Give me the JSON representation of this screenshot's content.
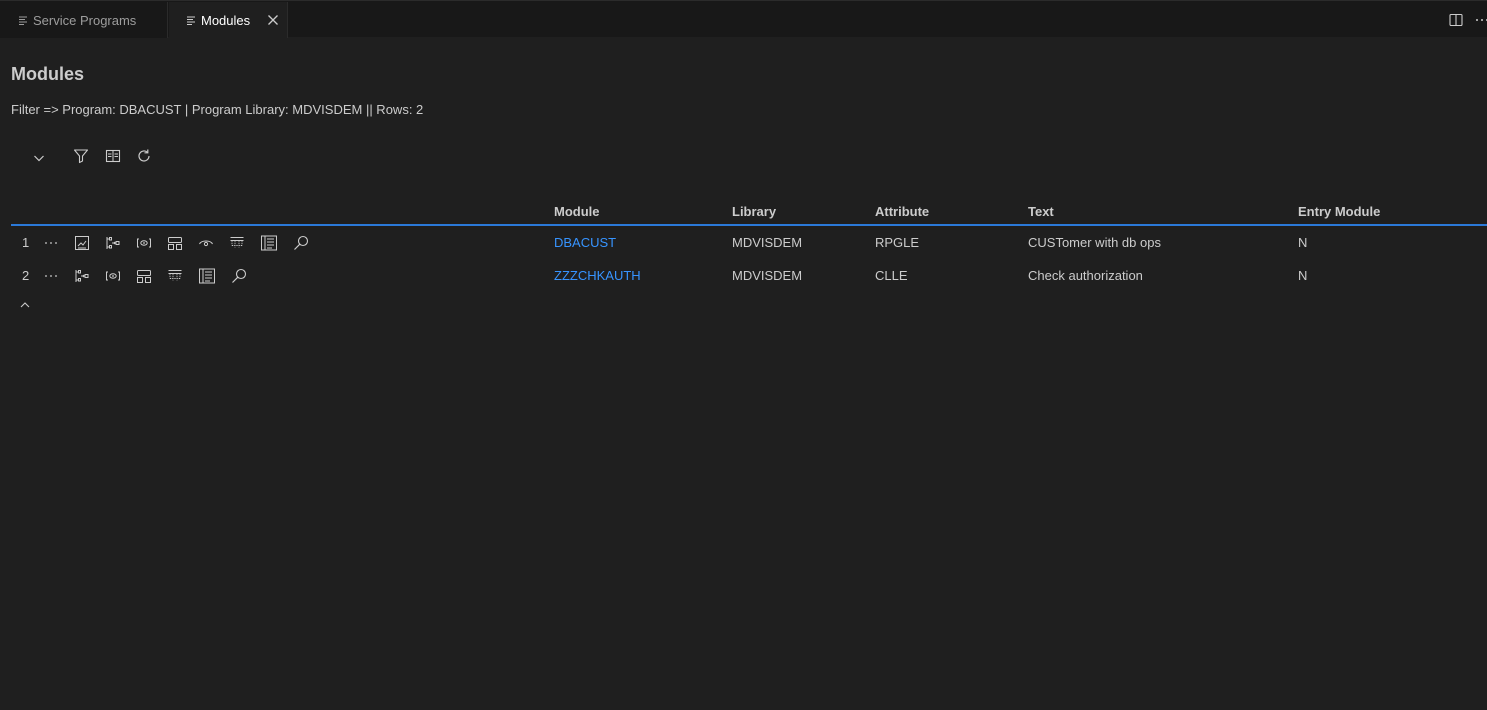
{
  "tabs": [
    {
      "label": "Service Programs",
      "active": false,
      "icon": "list-icon"
    },
    {
      "label": "Modules",
      "active": true,
      "icon": "list-icon"
    }
  ],
  "page": {
    "title": "Modules",
    "filter_text": "Filter => Program: DBACUST | Program Library: MDVISDEM || Rows: 2"
  },
  "toolbar": {
    "icons": [
      "chevron-down-icon",
      "filter-icon",
      "columns-icon",
      "refresh-icon"
    ]
  },
  "table": {
    "columns": [
      "Module",
      "Library",
      "Attribute",
      "Text",
      "Entry Module"
    ],
    "rows": [
      {
        "num": "1",
        "module": "DBACUST",
        "library": "MDVISDEM",
        "attribute": "RPGLE",
        "text": "CUSTomer with db ops",
        "entry": "N"
      },
      {
        "num": "2",
        "module": "ZZZCHKAUTH",
        "library": "MDVISDEM",
        "attribute": "CLLE",
        "text": "Check authorization",
        "entry": "N"
      }
    ]
  },
  "colors": {
    "background": "#1f1f1f",
    "tabbar": "#181818",
    "link": "#3794ff",
    "header_underline": "#2b79d8"
  }
}
